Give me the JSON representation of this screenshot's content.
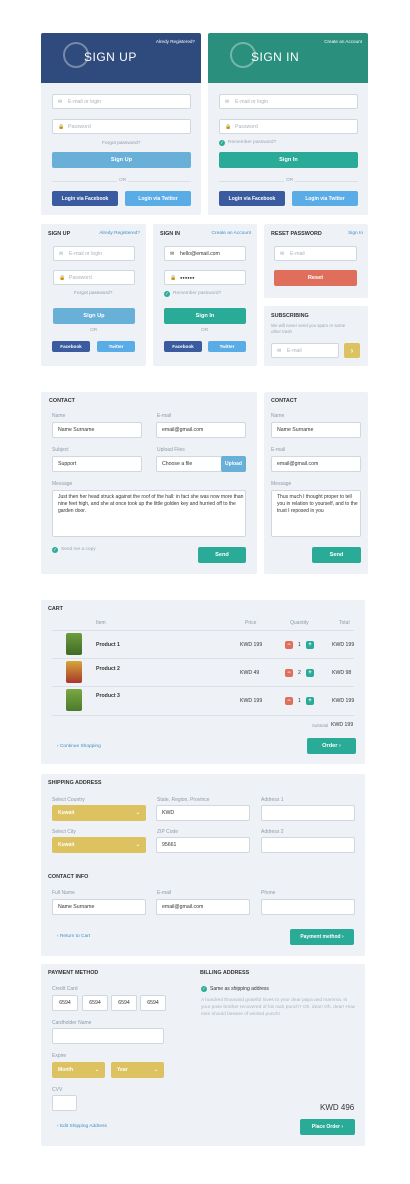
{
  "signup_hero": {
    "title": "SIGN UP",
    "link": "Alredy Registered?",
    "email_placeholder": "E-mail or login",
    "password_placeholder": "Password",
    "forgot": "Forgot password?",
    "button": "Sign Up",
    "or": "OR",
    "facebook": "Login via Facebook",
    "twitter": "Login via Twitter"
  },
  "signin_hero": {
    "title": "SIGN IN",
    "link": "Create an Account",
    "email_placeholder": "E-mail or login",
    "password_placeholder": "Password",
    "remember": "Remember password?",
    "button": "Sign In",
    "or": "OR",
    "facebook": "Login via Facebook",
    "twitter": "Login via Twitter"
  },
  "signup_small": {
    "title": "SIGN UP",
    "link": "Alredy Registered?",
    "email_placeholder": "E-mail or login",
    "password_placeholder": "Password",
    "forgot": "Forgot password?",
    "button": "Sign Up",
    "or": "OR",
    "facebook": "Facebook",
    "twitter": "Twitter"
  },
  "signin_small": {
    "title": "SIGN IN",
    "link": "Create an Account",
    "email_value": "hello@email.com",
    "password_value": "●●●●●●",
    "remember": "Remember password?",
    "button": "Sign In",
    "or": "OR",
    "facebook": "Facebook",
    "twitter": "Twitter"
  },
  "reset": {
    "title": "RESET PASSWORD",
    "link": "Sign In",
    "email_placeholder": "E-mail",
    "button": "Reset"
  },
  "subscribing": {
    "title": "SUBSCRIBING",
    "text": "We will never send you spam or some other trash",
    "email_placeholder": "E-mail",
    "button": "›"
  },
  "contact_large": {
    "title": "CONTACT",
    "name_label": "Name",
    "name_value": "Name Surname",
    "email_label": "E-mail",
    "email_value": "email@gmail.com",
    "subject_label": "Subject",
    "subject_value": "Support",
    "upload_label": "Upload Files",
    "upload_value": "Choose a file",
    "upload_button": "Upload",
    "message_label": "Message",
    "message_value": "Just then her head struck against the roof of the hall: in fact she was now more than nine feet high, and she at once took up the little golden key and hurried off to the garden door.",
    "copy": "Send me a copy",
    "send": "Send"
  },
  "contact_small": {
    "title": "CONTACT",
    "name_label": "Name",
    "name_value": "Name Surname",
    "email_label": "E-mail",
    "email_value": "email@gmail.com",
    "message_label": "Message",
    "message_value": "Thus much I thought proper to tell you in relation to yourself, and to the trust I reposed in you",
    "send": "Send"
  },
  "cart": {
    "title": "CART",
    "columns": [
      "Item",
      "Price",
      "Quantity",
      "Total"
    ],
    "rows": [
      {
        "name": "Product 1",
        "price": "KWD 199",
        "qty": "1",
        "total": "KWD 199"
      },
      {
        "name": "Product 2",
        "price": "KWD 49",
        "qty": "2",
        "total": "KWD 98"
      },
      {
        "name": "Product 3",
        "price": "KWD 199",
        "qty": "1",
        "total": "KWD 199"
      }
    ],
    "subtotal_label": "Subtotal",
    "subtotal": "KWD 199",
    "continue": "Continue Shopping",
    "order": "Order"
  },
  "shipping": {
    "title": "SHIPPING ADDRESS",
    "country_label": "Select Country",
    "country": "Kuwait",
    "state_label": "State, Region, Province",
    "state": "KWD",
    "address1_label": "Address 1",
    "city_label": "Select City",
    "city": "Kuwait",
    "zip_label": "ZIP Code",
    "zip": "95661",
    "address2_label": "Address 2",
    "contact_title": "CONTACT INFO",
    "fullname_label": "Full Name",
    "fullname": "Name Surname",
    "email_label": "E-mail",
    "email": "email@gmail.com",
    "phone_label": "Phone",
    "back": "Return to Cart",
    "next": "Payment method"
  },
  "payment": {
    "title": "PAYMENT METHOD",
    "card_label": "Credit Card",
    "card": [
      "6594",
      "6594",
      "6594",
      "6594"
    ],
    "holder_label": "Cardholder Name",
    "expire_label": "Expire",
    "month": "Month",
    "year": "Year",
    "cvv_label": "CVV",
    "billing_title": "BILLING ADDRESS",
    "same": "Same as shipping address",
    "billing_text": "A hundred thousand grateful loves to your dear papa and mamma. Is your pose brother recovered of his rack punch? Oh, dear! Oh, dear! How men should beware of wicked punch!",
    "total": "KWD 496",
    "back": "Edit Shipping Address",
    "place": "Place Order"
  },
  "colors": {
    "navy": "#2f4a7c",
    "green": "#2a8f7d",
    "teal": "#2aab97",
    "blue": "#69b0d9",
    "gold": "#dcc260",
    "red": "#e06e5d"
  }
}
